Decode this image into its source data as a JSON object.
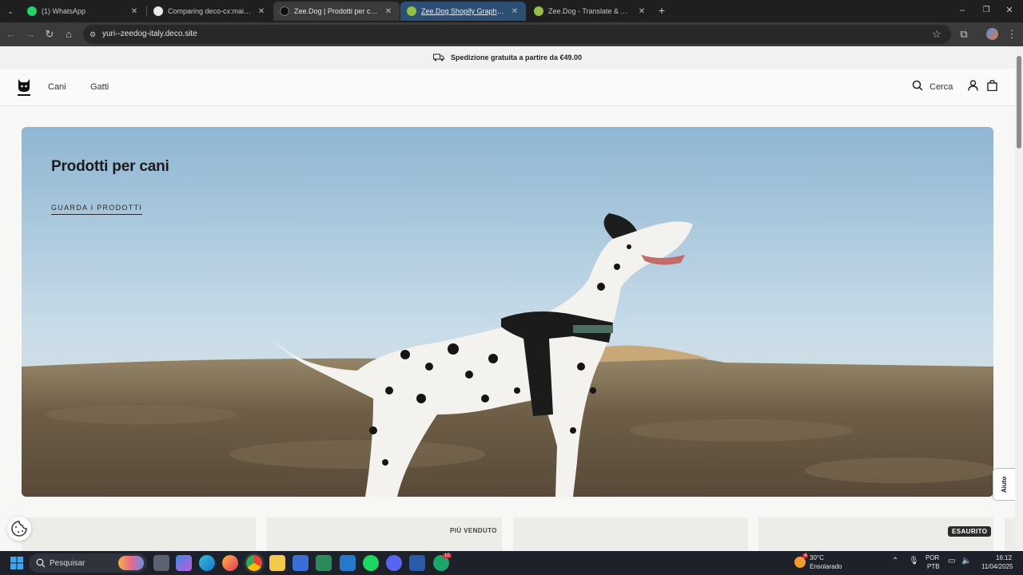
{
  "browser": {
    "tabs": [
      {
        "label": "(1) WhatsApp",
        "icon": "whatsapp-icon",
        "state": "normal"
      },
      {
        "label": "Comparing deco-cx:main...yuri:",
        "icon": "github-icon",
        "state": "normal"
      },
      {
        "label": "Zee.Dog | Prodotti per cani e g",
        "icon": "zeedog-icon",
        "state": "active"
      },
      {
        "label": "Zee.Dog Shopify GraphiQL Ap",
        "icon": "shopify-icon",
        "state": "hover"
      },
      {
        "label": "Zee.Dog - Translate & Adapt - S",
        "icon": "shopify-icon",
        "state": "normal"
      }
    ],
    "new_tab_glyph": "+",
    "address": "yuri--zeedog-italy.deco.site",
    "colors": {
      "tab_active": "#3b3b3b",
      "tab_hover": "#2d4f73",
      "chrome_bg": "#1f1f1f"
    }
  },
  "site": {
    "promo_text": "Spedizione gratuita a partire da €49.00",
    "nav": [
      "Cani",
      "Gatti"
    ],
    "search_label": "Cerca",
    "hero": {
      "title": "Prodotti per cani",
      "cta": "GUARDA I PRODOTTI"
    },
    "cards": [
      {
        "badge": ""
      },
      {
        "badge": "PIÙ VENDUTO"
      },
      {
        "badge": ""
      },
      {
        "badge": "ESAURITO"
      }
    ],
    "help_label": "Aiuto"
  },
  "taskbar": {
    "search_placeholder": "Pesquisar",
    "weather_temp": "30°C",
    "weather_desc": "Ensolarado",
    "weather_badge": "4",
    "lang_line1": "POR",
    "lang_line2": "PTB",
    "time": "16:12",
    "date": "11/04/2025",
    "discord_badge": "10"
  }
}
